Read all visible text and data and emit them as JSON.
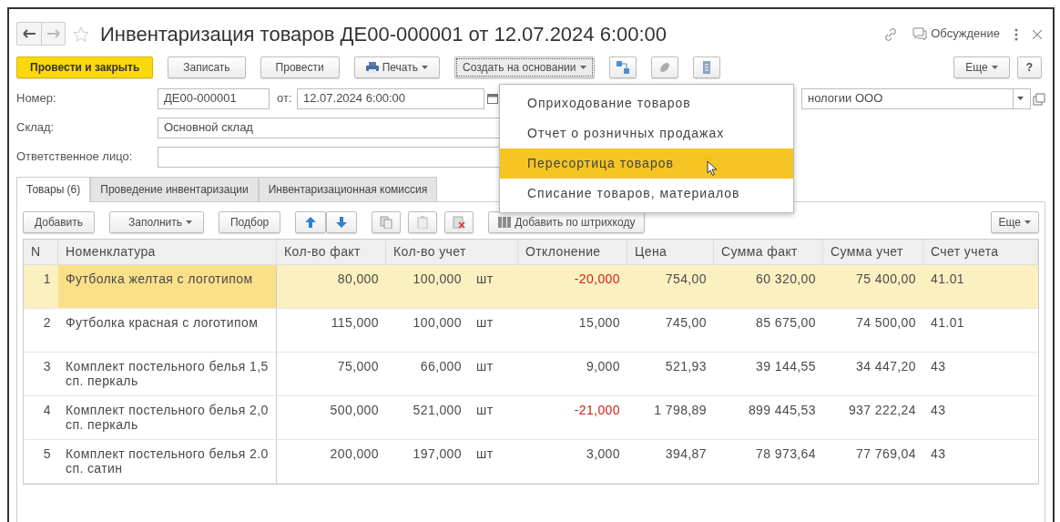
{
  "header": {
    "title": "Инвентаризация товаров ДЕ00-000001 от 12.07.2024 6:00:00",
    "discussion": "Обсуждение"
  },
  "toolbar": {
    "buttons": [
      {
        "label": "Провести и закрыть",
        "kind": "primary"
      },
      {
        "label": "Записать",
        "kind": "plain"
      },
      {
        "label": "Провести",
        "kind": "plain"
      },
      {
        "label": "Печать",
        "kind": "print"
      },
      {
        "label": "Создать на основании",
        "kind": "menu",
        "expanded": true
      }
    ],
    "more": "Еще",
    "help": "?"
  },
  "menu": [
    {
      "label": "Оприходование товаров",
      "selected": false
    },
    {
      "label": "Отчет о розничных продажах",
      "selected": false
    },
    {
      "label": "Пересортица товаров",
      "selected": true
    },
    {
      "label": "Списание товаров, материалов",
      "selected": false
    }
  ],
  "fields": {
    "number_label": "Номер:",
    "number": "ДЕ00-000001",
    "date_label": "от:",
    "date": "12.07.2024  6:00:00",
    "organization": "нологии ООО",
    "warehouse_label": "Склад:",
    "warehouse": "Основной склад",
    "responsible_label": "Ответственное лицо:"
  },
  "tabs": [
    {
      "label": "Товары (6)",
      "selected": true
    },
    {
      "label": "Проведение инвентаризации",
      "selected": false
    },
    {
      "label": "Инвентаризационная комиссия",
      "selected": false
    }
  ],
  "table_toolbar": {
    "add": "Добавить",
    "fill": "Заполнить",
    "pick": "Подбор",
    "barcode": "Добавить по штрихкоду",
    "more": "Еще"
  },
  "table": {
    "columns": [
      "N",
      "Номенклатура",
      "Кол-во факт",
      "Кол-во учет",
      "Отклонение",
      "Цена",
      "Сумма факт",
      "Сумма учет",
      "Счет учета"
    ],
    "rows": [
      {
        "n": "1",
        "name": "Футболка желтая с логотипом",
        "fact": "80,000",
        "account_qty": "100,000",
        "unit": "шт",
        "deviation": "-20,000",
        "negative": true,
        "price": "754,00",
        "sum_fact": "60 320,00",
        "sum_account": "75 400,00",
        "account": "41.01",
        "selected": true
      },
      {
        "n": "2",
        "name": "Футболка красная с логотипом",
        "fact": "115,000",
        "account_qty": "100,000",
        "unit": "шт",
        "deviation": "15,000",
        "negative": false,
        "price": "745,00",
        "sum_fact": "85 675,00",
        "sum_account": "74 500,00",
        "account": "41.01",
        "selected": false
      },
      {
        "n": "3",
        "name": "Комплект постельного белья 1,5 сп. перкаль",
        "fact": "75,000",
        "account_qty": "66,000",
        "unit": "шт",
        "deviation": "9,000",
        "negative": false,
        "price": "521,93",
        "sum_fact": "39 144,55",
        "sum_account": "34 447,20",
        "account": "43",
        "selected": false
      },
      {
        "n": "4",
        "name": "Комплект постельного белья 2,0 сп. перкаль",
        "fact": "500,000",
        "account_qty": "521,000",
        "unit": "шт",
        "deviation": "-21,000",
        "negative": true,
        "price": "1 798,89",
        "sum_fact": "899 445,53",
        "sum_account": "937 222,24",
        "account": "43",
        "selected": false
      },
      {
        "n": "5",
        "name": "Комплект постельного белья 2.0 сп. сатин",
        "fact": "200,000",
        "account_qty": "197,000",
        "unit": "шт",
        "deviation": "3,000",
        "negative": false,
        "price": "394,87",
        "sum_fact": "78 973,64",
        "sum_account": "77 769,04",
        "account": "43",
        "selected": false
      }
    ]
  }
}
